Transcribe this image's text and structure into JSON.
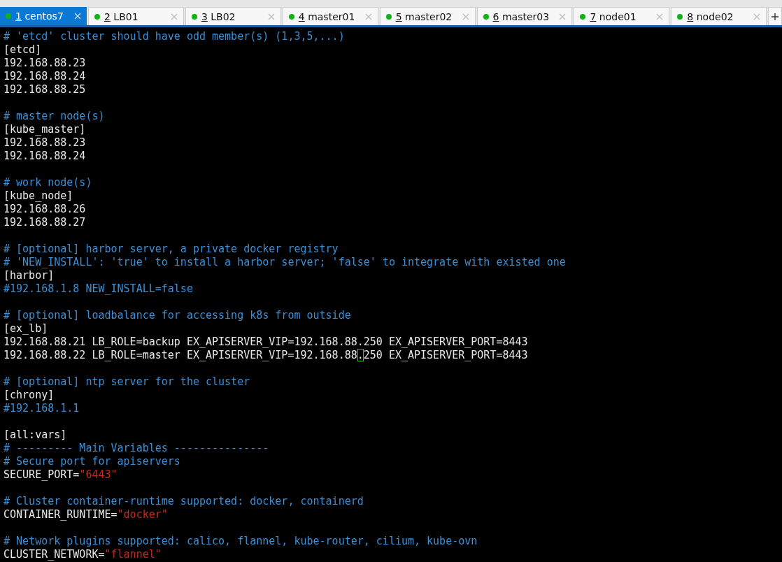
{
  "tabs": [
    {
      "number": "1",
      "label": "centos7",
      "selected": true
    },
    {
      "number": "2",
      "label": "LB01",
      "selected": false
    },
    {
      "number": "3",
      "label": "LB02",
      "selected": false
    },
    {
      "number": "4",
      "label": "master01",
      "selected": false
    },
    {
      "number": "5",
      "label": "master02",
      "selected": false
    },
    {
      "number": "6",
      "label": "master03",
      "selected": false
    },
    {
      "number": "7",
      "label": "node01",
      "selected": false
    },
    {
      "number": "8",
      "label": "node02",
      "selected": false
    }
  ],
  "terminal": {
    "lines": [
      {
        "kind": "text",
        "segments": [
          {
            "kind": "comment",
            "text": "# 'etcd' cluster should have odd member(s) (1,3,5,...)"
          }
        ]
      },
      {
        "kind": "text",
        "segments": [
          {
            "kind": "plain",
            "text": "[etcd]"
          }
        ]
      },
      {
        "kind": "text",
        "segments": [
          {
            "kind": "plain",
            "text": "192.168.88.23"
          }
        ]
      },
      {
        "kind": "text",
        "segments": [
          {
            "kind": "plain",
            "text": "192.168.88.24"
          }
        ]
      },
      {
        "kind": "text",
        "segments": [
          {
            "kind": "plain",
            "text": "192.168.88.25"
          }
        ]
      },
      {
        "kind": "blank"
      },
      {
        "kind": "text",
        "segments": [
          {
            "kind": "comment",
            "text": "# master node(s)"
          }
        ]
      },
      {
        "kind": "text",
        "segments": [
          {
            "kind": "plain",
            "text": "[kube_master]"
          }
        ]
      },
      {
        "kind": "text",
        "segments": [
          {
            "kind": "plain",
            "text": "192.168.88.23"
          }
        ]
      },
      {
        "kind": "text",
        "segments": [
          {
            "kind": "plain",
            "text": "192.168.88.24"
          }
        ]
      },
      {
        "kind": "blank"
      },
      {
        "kind": "text",
        "segments": [
          {
            "kind": "comment",
            "text": "# work node(s)"
          }
        ]
      },
      {
        "kind": "text",
        "segments": [
          {
            "kind": "plain",
            "text": "[kube_node]"
          }
        ]
      },
      {
        "kind": "text",
        "segments": [
          {
            "kind": "plain",
            "text": "192.168.88.26"
          }
        ]
      },
      {
        "kind": "text",
        "segments": [
          {
            "kind": "plain",
            "text": "192.168.88.27"
          }
        ]
      },
      {
        "kind": "blank"
      },
      {
        "kind": "text",
        "segments": [
          {
            "kind": "comment",
            "text": "# [optional] harbor server, a private docker registry"
          }
        ]
      },
      {
        "kind": "text",
        "segments": [
          {
            "kind": "comment",
            "text": "# 'NEW_INSTALL': 'true' to install a harbor server; 'false' to integrate with existed one"
          }
        ]
      },
      {
        "kind": "text",
        "segments": [
          {
            "kind": "plain",
            "text": "[harbor]"
          }
        ]
      },
      {
        "kind": "text",
        "segments": [
          {
            "kind": "comment",
            "text": "#192.168.1.8 NEW_INSTALL=false"
          }
        ]
      },
      {
        "kind": "blank"
      },
      {
        "kind": "text",
        "segments": [
          {
            "kind": "comment",
            "text": "# [optional] loadbalance for accessing k8s from outside"
          }
        ]
      },
      {
        "kind": "text",
        "segments": [
          {
            "kind": "plain",
            "text": "[ex_lb]"
          }
        ]
      },
      {
        "kind": "text",
        "segments": [
          {
            "kind": "plain",
            "text": "192.168.88.21 LB_ROLE=backup EX_APISERVER_VIP=192.168.88.250 EX_APISERVER_PORT=8443"
          }
        ]
      },
      {
        "kind": "text",
        "segments": [
          {
            "kind": "plain",
            "text": "192.168.88.22 LB_ROLE=master EX_APISERVER_VIP=192.168.88"
          },
          {
            "kind": "cursor",
            "text": "."
          },
          {
            "kind": "plain",
            "text": "250 EX_APISERVER_PORT=8443"
          }
        ]
      },
      {
        "kind": "blank"
      },
      {
        "kind": "text",
        "segments": [
          {
            "kind": "comment",
            "text": "# [optional] ntp server for the cluster"
          }
        ]
      },
      {
        "kind": "text",
        "segments": [
          {
            "kind": "plain",
            "text": "[chrony]"
          }
        ]
      },
      {
        "kind": "text",
        "segments": [
          {
            "kind": "comment",
            "text": "#192.168.1.1"
          }
        ]
      },
      {
        "kind": "blank"
      },
      {
        "kind": "text",
        "segments": [
          {
            "kind": "plain",
            "text": "[all:vars]"
          }
        ]
      },
      {
        "kind": "text",
        "segments": [
          {
            "kind": "comment",
            "text": "# --------- Main Variables ---------------"
          }
        ]
      },
      {
        "kind": "text",
        "segments": [
          {
            "kind": "comment",
            "text": "# Secure port for apiservers"
          }
        ]
      },
      {
        "kind": "text",
        "segments": [
          {
            "kind": "plain",
            "text": "SECURE_PORT="
          },
          {
            "kind": "string",
            "text": "\"6443\""
          }
        ]
      },
      {
        "kind": "blank"
      },
      {
        "kind": "text",
        "segments": [
          {
            "kind": "comment",
            "text": "# Cluster container-runtime supported: docker, containerd"
          }
        ]
      },
      {
        "kind": "text",
        "segments": [
          {
            "kind": "plain",
            "text": "CONTAINER_RUNTIME="
          },
          {
            "kind": "string",
            "text": "\"docker\""
          }
        ]
      },
      {
        "kind": "blank"
      },
      {
        "kind": "text",
        "segments": [
          {
            "kind": "comment",
            "text": "# Network plugins supported: calico, flannel, kube-router, cilium, kube-ovn"
          }
        ]
      },
      {
        "kind": "text",
        "segments": [
          {
            "kind": "plain",
            "text": "CLUSTER_NETWORK="
          },
          {
            "kind": "string",
            "text": "\"flannel\""
          }
        ]
      }
    ]
  }
}
